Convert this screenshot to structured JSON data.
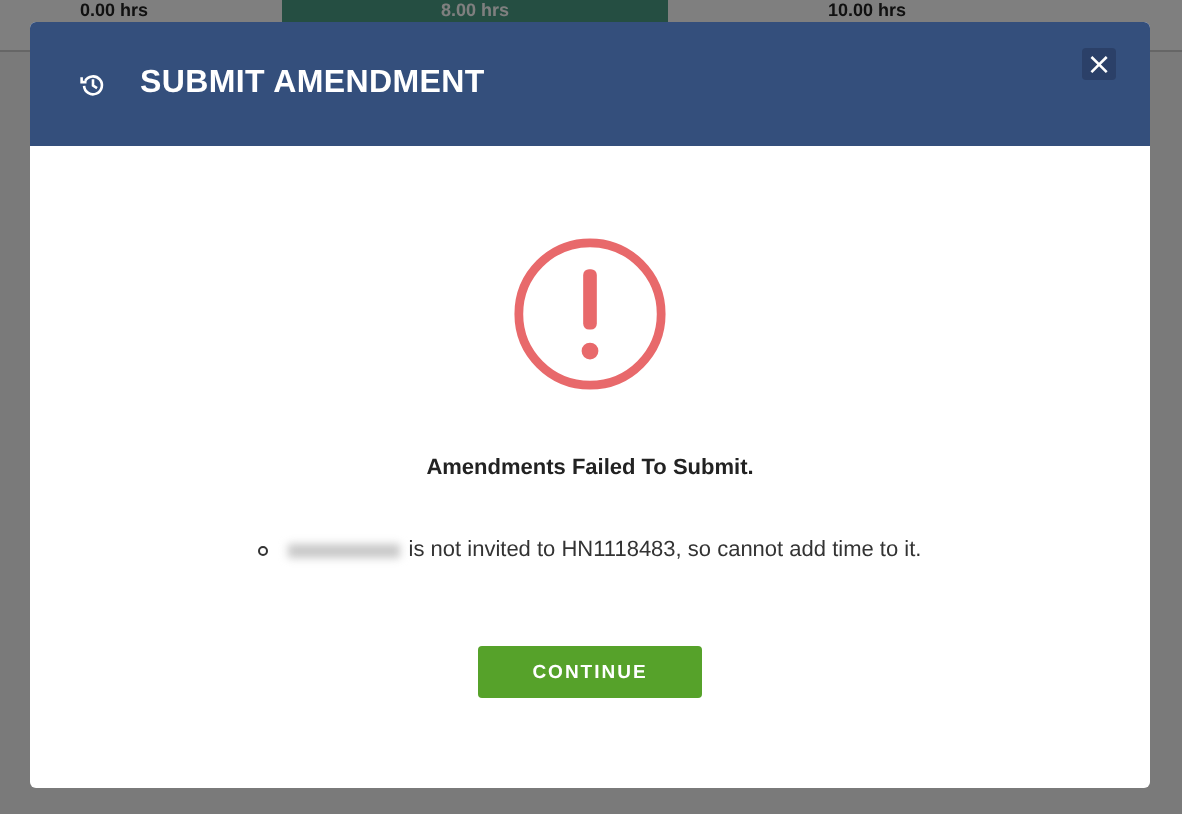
{
  "background": {
    "columns": [
      {
        "value": "0.00 hrs",
        "selected": false
      },
      {
        "value": "8.00 hrs",
        "selected": true
      },
      {
        "value": "10.00 hrs",
        "selected": false
      }
    ]
  },
  "dialog": {
    "title": "SUBMIT AMENDMENT",
    "close": "×",
    "heading": "Amendments Failed To Submit.",
    "errors": [
      {
        "text": "is not invited to HN1118483, so cannot add time to it."
      }
    ],
    "button": "CONTINUE"
  }
}
